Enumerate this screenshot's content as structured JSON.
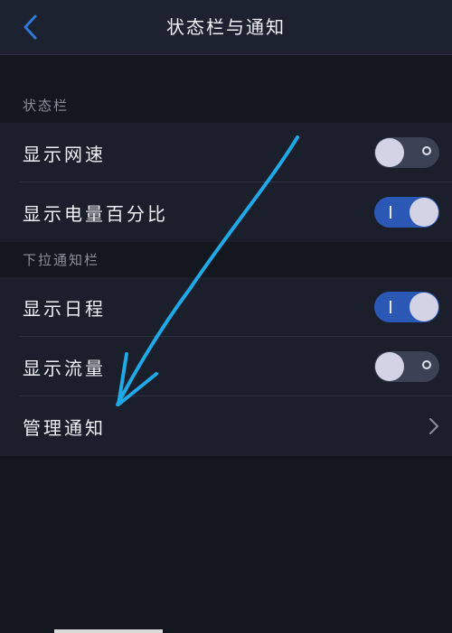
{
  "header": {
    "title": "状态栏与通知"
  },
  "sections": [
    {
      "title": "状态栏",
      "items": [
        {
          "label": "显示网速",
          "toggle": "off"
        },
        {
          "label": "显示电量百分比",
          "toggle": "on"
        }
      ]
    },
    {
      "title": "下拉通知栏",
      "items": [
        {
          "label": "显示日程",
          "toggle": "on"
        },
        {
          "label": "显示流量",
          "toggle": "off"
        },
        {
          "label": "管理通知",
          "toggle": null
        }
      ]
    }
  ],
  "colors": {
    "background": "#131720",
    "row_background": "#1a1f2b",
    "toggle_on": "#2b58b4",
    "toggle_off": "#3b4254",
    "accent_back": "#2f78d8",
    "annotation_arrow": "#1fa9e6"
  },
  "icons": {
    "back": "chevron-left-icon",
    "manage": "chevron-right-icon"
  }
}
